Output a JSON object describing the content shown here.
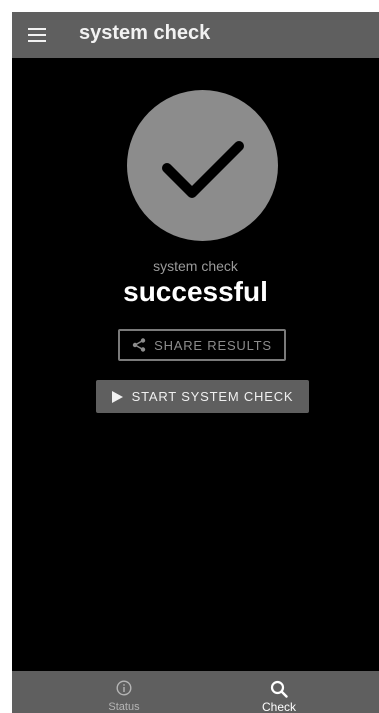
{
  "app_bar": {
    "title": "system check",
    "menu_icon": "menu-icon"
  },
  "result": {
    "icon": "checkmark-icon",
    "label": "system check",
    "value": "successful"
  },
  "actions": {
    "share_label": "SHARE RESULTS",
    "share_icon": "share-icon",
    "start_label": "START SYSTEM CHECK",
    "start_icon": "play-icon"
  },
  "bottom_nav": {
    "items": [
      {
        "label": "Status",
        "icon": "info-icon",
        "active": false
      },
      {
        "label": "Check",
        "icon": "search-icon",
        "active": true
      }
    ]
  },
  "colors": {
    "app_bar": "#5f5f5f",
    "background": "#000000",
    "circle": "#8c8c8c",
    "text_primary": "#ffffff",
    "text_muted": "#9a9a9a"
  }
}
